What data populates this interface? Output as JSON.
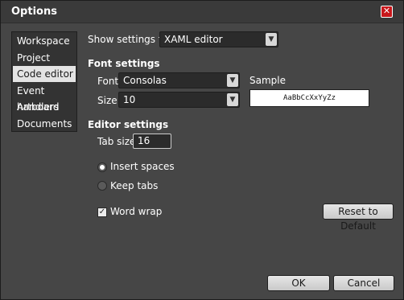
{
  "window": {
    "title": "Options",
    "close_glyph": "✕"
  },
  "sidebar": {
    "items": [
      {
        "label": "Workspace"
      },
      {
        "label": "Project"
      },
      {
        "label": "Code editor",
        "selected": true
      },
      {
        "label": "Event handlers"
      },
      {
        "label": "Artboard"
      },
      {
        "label": "Documents"
      }
    ]
  },
  "main": {
    "show_settings_label": "Show settings for",
    "show_settings_value": "XAML editor",
    "font_settings": {
      "heading": "Font settings",
      "font_label": "Font",
      "font_value": "Consolas",
      "size_label": "Size",
      "size_value": "10",
      "sample_label": "Sample",
      "sample_text": "AaBbCcXxYyZz"
    },
    "editor_settings": {
      "heading": "Editor settings",
      "tab_size_label": "Tab size",
      "tab_size_value": "16",
      "insert_spaces_label": "Insert spaces",
      "insert_spaces_checked": true,
      "keep_tabs_label": "Keep tabs",
      "keep_tabs_checked": false,
      "word_wrap_label": "Word wrap",
      "word_wrap_checked": true,
      "reset_label": "Reset to Default"
    }
  },
  "footer": {
    "ok_label": "OK",
    "cancel_label": "Cancel"
  },
  "icons": {
    "dropdown_arrow": "chevron-down-icon",
    "checkmark": "check-icon"
  },
  "colors": {
    "close_button": "#c8171b",
    "selected_item_bg": "#e4e4e4",
    "panel_bg": "#464646"
  }
}
